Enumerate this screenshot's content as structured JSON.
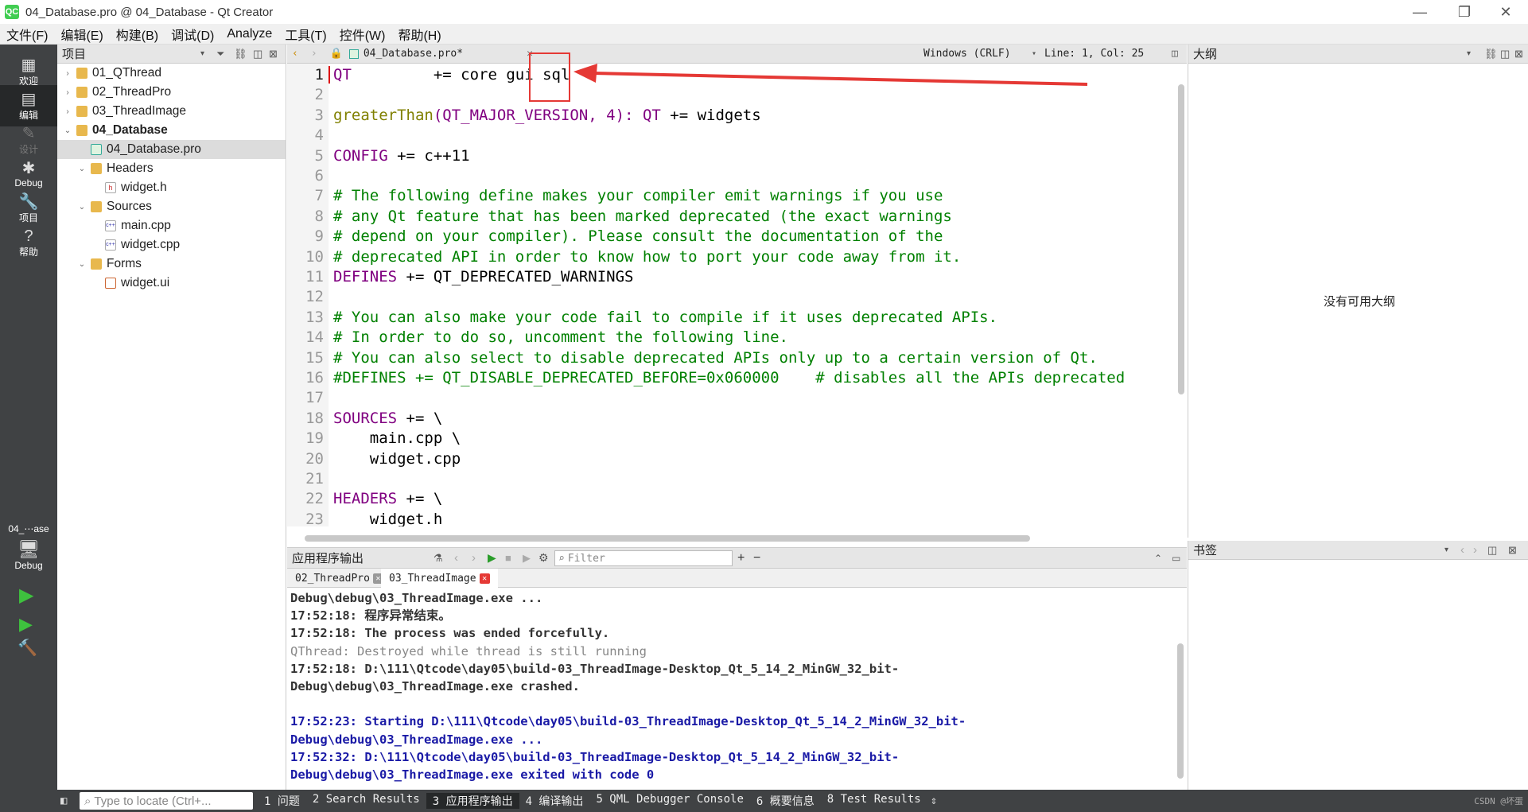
{
  "window": {
    "title": "04_Database.pro @ 04_Database - Qt Creator",
    "logo_text": "QC",
    "minimize": "—",
    "maximize": "❐",
    "close": "✕"
  },
  "menubar": [
    "文件(F)",
    "编辑(E)",
    "构建(B)",
    "调试(D)",
    "Analyze",
    "工具(T)",
    "控件(W)",
    "帮助(H)"
  ],
  "modebar": {
    "modes": [
      {
        "icon": "grid-icon",
        "glyph": "▦",
        "label": "欢迎"
      },
      {
        "icon": "edit-icon",
        "glyph": "▤",
        "label": "编辑"
      },
      {
        "icon": "design-icon",
        "glyph": "✎",
        "label": "设计"
      },
      {
        "icon": "bug-icon",
        "glyph": "✱",
        "label": "Debug"
      },
      {
        "icon": "wrench-icon",
        "glyph": "🔧",
        "label": "项目"
      },
      {
        "icon": "help-icon",
        "glyph": "?",
        "label": "帮助"
      }
    ],
    "kit_label": "04_⋯ase",
    "kit_mode": "Debug",
    "run_glyph": "▶",
    "debug_run_glyph": "▶",
    "build_glyph": "🔨"
  },
  "sidebar": {
    "title": "项目",
    "tree": [
      {
        "label": "01_QThread",
        "depth": 0,
        "arrow": "›",
        "type": "folder",
        "bold": false
      },
      {
        "label": "02_ThreadPro",
        "depth": 0,
        "arrow": "›",
        "type": "folder",
        "bold": false
      },
      {
        "label": "03_ThreadImage",
        "depth": 0,
        "arrow": "›",
        "type": "folder",
        "bold": false
      },
      {
        "label": "04_Database",
        "depth": 0,
        "arrow": "⌄",
        "type": "folder",
        "bold": true
      },
      {
        "label": "04_Database.pro",
        "depth": 1,
        "arrow": "",
        "type": "pro",
        "bold": false,
        "selected": true
      },
      {
        "label": "Headers",
        "depth": 1,
        "arrow": "⌄",
        "type": "folder",
        "bold": false
      },
      {
        "label": "widget.h",
        "depth": 2,
        "arrow": "",
        "type": "h",
        "bold": false
      },
      {
        "label": "Sources",
        "depth": 1,
        "arrow": "⌄",
        "type": "folder",
        "bold": false
      },
      {
        "label": "main.cpp",
        "depth": 2,
        "arrow": "",
        "type": "cpp",
        "bold": false
      },
      {
        "label": "widget.cpp",
        "depth": 2,
        "arrow": "",
        "type": "cpp",
        "bold": false
      },
      {
        "label": "Forms",
        "depth": 1,
        "arrow": "⌄",
        "type": "folder",
        "bold": false
      },
      {
        "label": "widget.ui",
        "depth": 2,
        "arrow": "",
        "type": "ui",
        "bold": false
      }
    ]
  },
  "editor": {
    "filename": "04_Database.pro*",
    "encoding": "Windows (CRLF)",
    "position": "Line: 1, Col: 25",
    "lines": [
      [
        {
          "t": "QT",
          "c": "kw"
        },
        {
          "t": "         += core gui ",
          "c": ""
        },
        {
          "t": "sql",
          "c": ""
        }
      ],
      [],
      [
        {
          "t": "greaterThan",
          "c": "fn"
        },
        {
          "t": "(QT_MAJOR_VERSION, 4): ",
          "c": "kw"
        },
        {
          "t": "QT",
          "c": "kw"
        },
        {
          "t": " += widgets",
          "c": ""
        }
      ],
      [],
      [
        {
          "t": "CONFIG",
          "c": "kw"
        },
        {
          "t": " += c++11",
          "c": ""
        }
      ],
      [],
      [
        {
          "t": "# The following define makes your compiler emit warnings if you use",
          "c": "cm"
        }
      ],
      [
        {
          "t": "# any Qt feature that has been marked deprecated (the exact warnings",
          "c": "cm"
        }
      ],
      [
        {
          "t": "# depend on your compiler). Please consult the documentation of the",
          "c": "cm"
        }
      ],
      [
        {
          "t": "# deprecated API in order to know how to port your code away from it.",
          "c": "cm"
        }
      ],
      [
        {
          "t": "DEFINES",
          "c": "kw"
        },
        {
          "t": " += QT_DEPRECATED_WARNINGS",
          "c": ""
        }
      ],
      [],
      [
        {
          "t": "# You can also make your code fail to compile if it uses deprecated APIs.",
          "c": "cm"
        }
      ],
      [
        {
          "t": "# In order to do so, uncomment the following line.",
          "c": "cm"
        }
      ],
      [
        {
          "t": "# You can also select to disable deprecated APIs only up to a certain version of Qt.",
          "c": "cm"
        }
      ],
      [
        {
          "t": "#DEFINES += QT_DISABLE_DEPRECATED_BEFORE=0x060000    # disables all the APIs deprecated",
          "c": "cm"
        }
      ],
      [],
      [
        {
          "t": "SOURCES",
          "c": "kw"
        },
        {
          "t": " += \\",
          "c": ""
        }
      ],
      [
        {
          "t": "    main.cpp \\",
          "c": ""
        }
      ],
      [
        {
          "t": "    widget.cpp",
          "c": ""
        }
      ],
      [],
      [
        {
          "t": "HEADERS",
          "c": "kw"
        },
        {
          "t": " += \\",
          "c": ""
        }
      ],
      [
        {
          "t": "    widget.h",
          "c": ""
        }
      ]
    ]
  },
  "outline": {
    "title": "大纲",
    "empty_text": "没有可用大纲"
  },
  "bookmarks": {
    "title": "书签"
  },
  "output": {
    "title": "应用程序输出",
    "filter_placeholder": "Filter",
    "tabs": [
      "02_ThreadPro",
      "03_ThreadImage"
    ],
    "lines": [
      {
        "t": "Debug\\debug\\03_ThreadImage.exe ...",
        "c": "dark"
      },
      {
        "t": "17:52:18: 程序异常结束。",
        "c": "dark"
      },
      {
        "t": "17:52:18: The process was ended forcefully.",
        "c": "dark"
      },
      {
        "t": "QThread: Destroyed while thread is still running",
        "c": "gray"
      },
      {
        "t": "17:52:18: D:\\111\\Qtcode\\day05\\build-03_ThreadImage-Desktop_Qt_5_14_2_MinGW_32_bit-",
        "c": "dark"
      },
      {
        "t": "Debug\\debug\\03_ThreadImage.exe crashed.",
        "c": "dark"
      },
      {
        "t": "",
        "c": "dark"
      },
      {
        "t": "17:52:23: Starting D:\\111\\Qtcode\\day05\\build-03_ThreadImage-Desktop_Qt_5_14_2_MinGW_32_bit-",
        "c": "blue"
      },
      {
        "t": "Debug\\debug\\03_ThreadImage.exe ...",
        "c": "blue"
      },
      {
        "t": "17:52:32: D:\\111\\Qtcode\\day05\\build-03_ThreadImage-Desktop_Qt_5_14_2_MinGW_32_bit-",
        "c": "blue"
      },
      {
        "t": "Debug\\debug\\03_ThreadImage.exe exited with code 0",
        "c": "blue"
      }
    ]
  },
  "statusbar": {
    "locate_placeholder": "Type to locate (Ctrl+...",
    "panes": [
      "1 问题",
      "2 Search Results",
      "3 应用程序输出",
      "4 编译输出",
      "5 QML Debugger Console",
      "6 概要信息",
      "8 Test Results"
    ],
    "watermark": "CSDN @坏蛋"
  },
  "colors": {
    "annotation_red": "#e53935",
    "modebar_bg": "#404244"
  }
}
